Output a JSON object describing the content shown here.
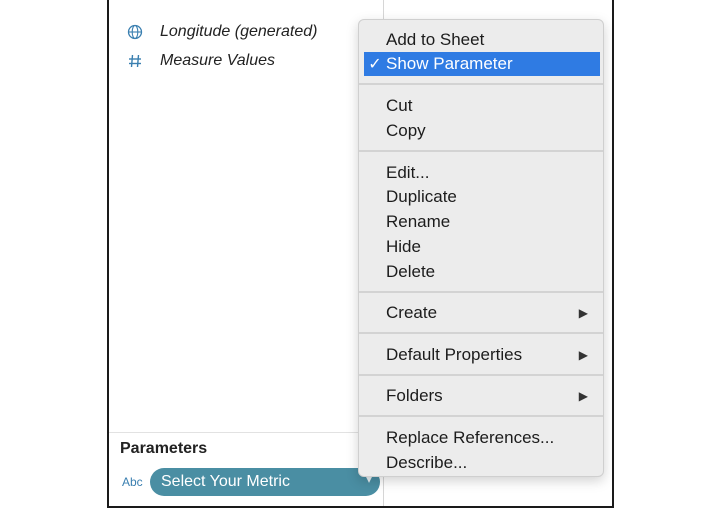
{
  "data_pane": {
    "fields": [
      {
        "label": "Longitude (generated)",
        "icon": "globe-icon"
      },
      {
        "label": "Measure Values",
        "icon": "hash-icon"
      }
    ]
  },
  "parameters": {
    "header": "Parameters",
    "type_label": "Abc",
    "pill_label": "Select Your Metric"
  },
  "context_menu": {
    "add_to_sheet": "Add to Sheet",
    "show_parameter": "Show Parameter",
    "show_parameter_check": "✓",
    "cut": "Cut",
    "copy": "Copy",
    "edit": "Edit...",
    "duplicate": "Duplicate",
    "rename": "Rename",
    "hide": "Hide",
    "delete": "Delete",
    "create": "Create",
    "default_properties": "Default Properties",
    "folders": "Folders",
    "replace_references": "Replace References...",
    "describe": "Describe...",
    "submenu_arrow": "▶"
  },
  "colors": {
    "selection": "#2f7be3",
    "pill": "#4a8ea3",
    "type_label": "#3a7fb0"
  }
}
